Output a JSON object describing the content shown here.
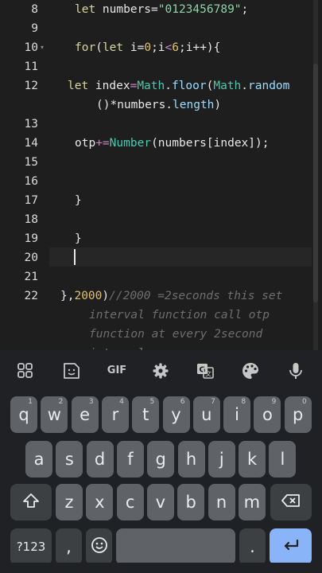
{
  "editor": {
    "lines": [
      {
        "no": "8",
        "fold": "",
        "parts": [
          {
            "t": "let ",
            "c": "kw"
          },
          {
            "t": "numbers=",
            "c": "var"
          },
          {
            "t": "\"0123456789\"",
            "c": "str"
          },
          {
            "t": ";",
            "c": "var"
          }
        ]
      },
      {
        "no": "9",
        "fold": "",
        "parts": []
      },
      {
        "no": "10",
        "fold": "▾",
        "parts": [
          {
            "t": "for",
            "c": "kw"
          },
          {
            "t": "(",
            "c": "var"
          },
          {
            "t": "let ",
            "c": "kw"
          },
          {
            "t": "i=",
            "c": "var"
          },
          {
            "t": "0",
            "c": "num"
          },
          {
            "t": ";i",
            "c": "var"
          },
          {
            "t": "<",
            "c": "op"
          },
          {
            "t": "6",
            "c": "num"
          },
          {
            "t": ";i++){",
            "c": "var"
          }
        ]
      },
      {
        "no": "11",
        "fold": "",
        "parts": []
      },
      {
        "no": "12",
        "fold": "",
        "parts": [
          {
            "t": "let ",
            "c": "kw"
          },
          {
            "t": "index",
            "c": "var"
          },
          {
            "t": "=",
            "c": "op"
          },
          {
            "t": "Math",
            "c": "obj"
          },
          {
            "t": ".",
            "c": "var"
          },
          {
            "t": "floor",
            "c": "prp"
          },
          {
            "t": "(",
            "c": "var"
          },
          {
            "t": "Math",
            "c": "obj"
          },
          {
            "t": ".",
            "c": "var"
          },
          {
            "t": "random",
            "c": "prp"
          }
        ]
      },
      {
        "no": "",
        "fold": "",
        "parts": [
          {
            "t": "()*numbers.",
            "c": "var"
          },
          {
            "t": "length",
            "c": "prp"
          },
          {
            "t": ")",
            "c": "var"
          }
        ]
      },
      {
        "no": "13",
        "fold": "",
        "parts": []
      },
      {
        "no": "14",
        "fold": "",
        "parts": [
          {
            "t": "otp",
            "c": "var"
          },
          {
            "t": "+=",
            "c": "op"
          },
          {
            "t": "Number",
            "c": "obj"
          },
          {
            "t": "(numbers[index]);",
            "c": "var"
          }
        ]
      },
      {
        "no": "15",
        "fold": "",
        "parts": []
      },
      {
        "no": "16",
        "fold": "",
        "parts": []
      },
      {
        "no": "17",
        "fold": "",
        "parts": [
          {
            "t": "}",
            "c": "var"
          }
        ]
      },
      {
        "no": "18",
        "fold": "",
        "parts": []
      },
      {
        "no": "19",
        "fold": "",
        "parts": [
          {
            "t": "}",
            "c": "var"
          }
        ]
      },
      {
        "no": "20",
        "fold": "",
        "parts": []
      },
      {
        "no": "21",
        "fold": "",
        "parts": []
      },
      {
        "no": "22",
        "fold": "",
        "parts": [
          {
            "t": "},",
            "c": "var"
          },
          {
            "t": "2000",
            "c": "num"
          },
          {
            "t": ")",
            "c": "var"
          },
          {
            "t": "//2000 =2seconds this set",
            "c": "cm"
          }
        ]
      },
      {
        "no": "",
        "fold": "",
        "parts": [
          {
            "t": "interval function call otp",
            "c": "cm"
          }
        ]
      },
      {
        "no": "",
        "fold": "",
        "parts": [
          {
            "t": "function at every 2second",
            "c": "cm"
          }
        ]
      },
      {
        "no": "",
        "fold": "",
        "parts": [
          {
            "t": "interval",
            "c": "cm"
          }
        ]
      }
    ]
  },
  "keyboard": {
    "toolbar": {
      "apps": "apps-grid-icon",
      "sticker": "sticker-icon",
      "gif": "GIF",
      "settings": "gear-icon",
      "translate": "translate-icon",
      "theme": "palette-icon",
      "voice": "microphone-icon"
    },
    "row1": [
      {
        "k": "q",
        "h": "1"
      },
      {
        "k": "w",
        "h": "2"
      },
      {
        "k": "e",
        "h": "3"
      },
      {
        "k": "r",
        "h": "4"
      },
      {
        "k": "t",
        "h": "5"
      },
      {
        "k": "y",
        "h": "6"
      },
      {
        "k": "u",
        "h": "7"
      },
      {
        "k": "i",
        "h": "8"
      },
      {
        "k": "o",
        "h": "9"
      },
      {
        "k": "p",
        "h": "0"
      }
    ],
    "row2": [
      "a",
      "s",
      "d",
      "f",
      "g",
      "h",
      "j",
      "k",
      "l"
    ],
    "row3": [
      "z",
      "x",
      "c",
      "v",
      "b",
      "n",
      "m"
    ],
    "symbols": "?123",
    "comma": ",",
    "period": ".",
    "colors": {
      "key": "#5f6368",
      "dark_key": "#3c4043",
      "enter": "#8ab4f8",
      "bg": "#202124"
    }
  }
}
